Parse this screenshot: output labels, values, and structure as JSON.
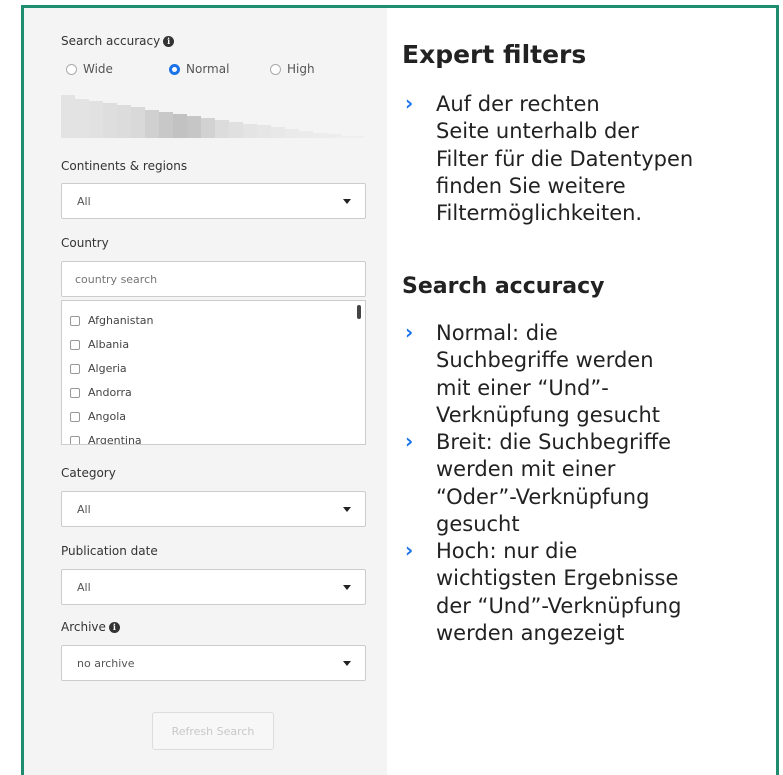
{
  "filters": {
    "search_accuracy": {
      "label": "Search accuracy",
      "options": [
        "Wide",
        "Normal",
        "High"
      ],
      "selected": "Normal"
    },
    "continents": {
      "label": "Continents & regions",
      "value": "All"
    },
    "country": {
      "label": "Country",
      "search_placeholder": "country search",
      "items": [
        "Afghanistan",
        "Albania",
        "Algeria",
        "Andorra",
        "Angola",
        "Argentina"
      ]
    },
    "category": {
      "label": "Category",
      "value": "All"
    },
    "publication_date": {
      "label": "Publication date",
      "value": "All"
    },
    "archive": {
      "label": "Archive",
      "value": "no archive"
    },
    "refresh_label": "Refresh Search"
  },
  "help": {
    "expert_heading": "Expert filters",
    "expert_bullets": [
      [
        "Auf der rechten",
        "Seite unterhalb der",
        "Filter für die Datentypen",
        "finden Sie weitere",
        "Filtermöglichkeiten."
      ]
    ],
    "accuracy_heading": "Search accuracy",
    "accuracy_bullets": [
      [
        "Normal: die",
        "Suchbegriffe werden",
        "mit einer “Und”-",
        "Verknüpfung gesucht"
      ],
      [
        "Breit: die Suchbegriffe",
        "werden mit einer",
        "“Oder”-Verknüpfung",
        "gesucht"
      ],
      [
        "Hoch: nur die",
        "wichtigsten Ergebnisse",
        "der “Und”-Verknüpfung",
        "werden angezeigt"
      ]
    ]
  },
  "colors": {
    "frame": "#1e8c6e",
    "accent": "#1a73e8",
    "panel_bg": "#f4f4f4"
  },
  "icons": {
    "info": "info-icon",
    "bullet": "chevron-right-icon",
    "dropdown": "caret-down-icon"
  }
}
